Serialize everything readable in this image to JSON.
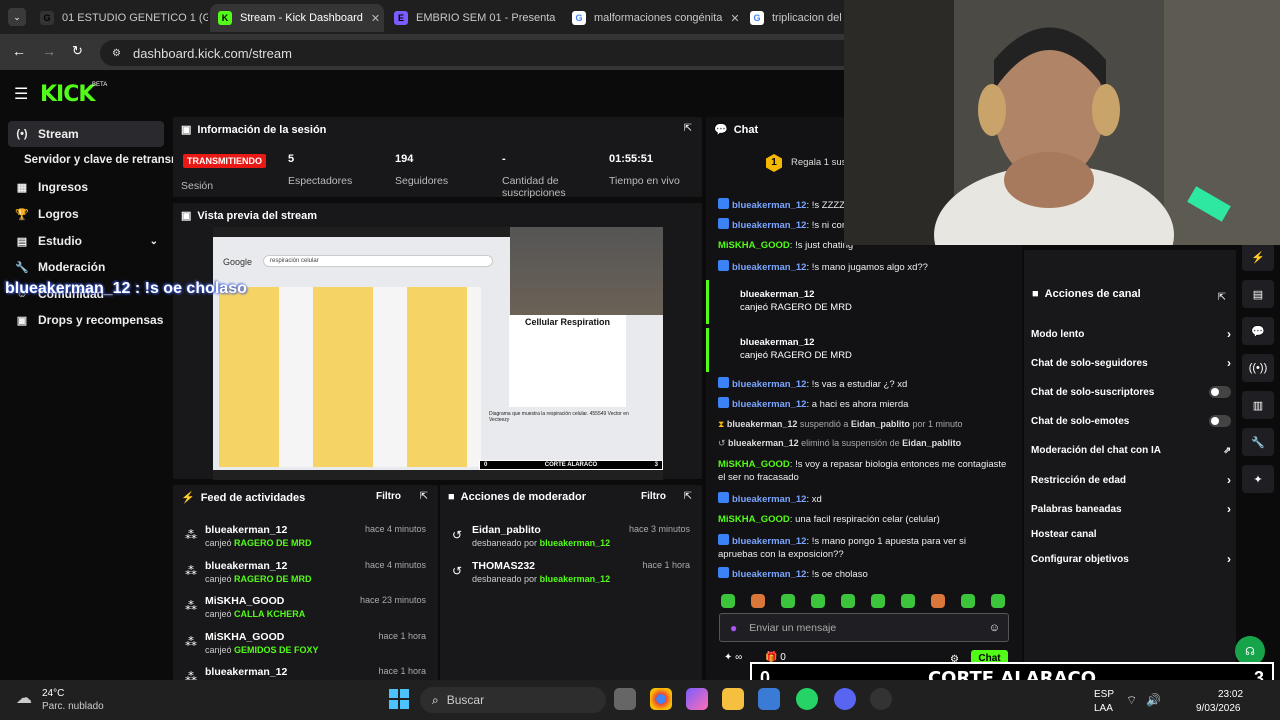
{
  "browser": {
    "tabs": [
      {
        "label": "01 ESTUDIO GENETICO 1 (G",
        "fav": "G",
        "color": "#333"
      },
      {
        "label": "Stream - Kick Dashboard",
        "fav": "K",
        "color": "#53fc18"
      },
      {
        "label": "EMBRIO SEM 01 - Presenta",
        "fav": "E",
        "color": "#7b5cff"
      },
      {
        "label": "malformaciones congénita",
        "fav": "G",
        "color": "#fff"
      },
      {
        "label": "triplicacion del cr",
        "fav": "G",
        "color": "#fff"
      }
    ],
    "url": "dashboard.kick.com/stream"
  },
  "kick": {
    "logo": "KICK",
    "beta": "BETA",
    "sidebar": [
      {
        "label": "Stream",
        "icon": "(•)"
      },
      {
        "label": "Servidor y clave de retransm",
        "icon": ""
      },
      {
        "label": "Ingresos",
        "icon": "▦"
      },
      {
        "label": "Logros",
        "icon": "🏆"
      },
      {
        "label": "Estudio",
        "icon": "▤"
      },
      {
        "label": "Moderación",
        "icon": "🔧"
      },
      {
        "label": "Comunidad",
        "icon": "☺"
      },
      {
        "label": "Drops y recompensas",
        "icon": "▣"
      }
    ],
    "overlay_chat": "blueakerman_12 : !s oe cholaso",
    "session": {
      "title": "Información de la sesión",
      "badge": "TRANSMITIENDO",
      "badge_label": "Sesión",
      "stats": [
        {
          "value": "5",
          "label": "Espectadores"
        },
        {
          "value": "194",
          "label": "Seguidores"
        },
        {
          "value": "-",
          "label": "Cantidad de suscripciones"
        },
        {
          "value": "01:55:51",
          "label": "Tiempo en vivo"
        }
      ]
    },
    "preview": {
      "title": "Vista previa del stream",
      "search_text": "respiración celular",
      "card_title": "Cellular Respiration",
      "card_caption": "Diagrama que muestra la respiración celular. 455549 Vector en Vecteezy",
      "bottom_text": "CORTE ALARACO",
      "score_left": "0",
      "score_right": "3"
    },
    "feed": {
      "title": "Feed de actividades",
      "filter": "Filtro",
      "rows": [
        {
          "user": "blueakerman_12",
          "action": "canjeó",
          "item": "RAGERO DE MRD",
          "time": "hace 4 minutos"
        },
        {
          "user": "blueakerman_12",
          "action": "canjeó",
          "item": "RAGERO DE MRD",
          "time": "hace 4 minutos"
        },
        {
          "user": "MiSKHA_GOOD",
          "action": "canjeó",
          "item": "CALLA KCHERA",
          "time": "hace 23 minutos"
        },
        {
          "user": "MiSKHA_GOOD",
          "action": "canjeó",
          "item": "GEMIDOS DE FOXY",
          "time": "hace 1 hora"
        },
        {
          "user": "blueakerman_12",
          "action": "",
          "item": "",
          "time": "hace 1 hora"
        }
      ]
    },
    "modactions": {
      "title": "Acciones de moderador",
      "filter": "Filtro",
      "rows": [
        {
          "user": "Eidan_pablito",
          "action": "desbaneado por",
          "by": "blueakerman_12",
          "time": "hace 3 minutos"
        },
        {
          "user": "THOMAS232",
          "action": "desbaneado por",
          "by": "blueakerman_12",
          "time": "hace 1 hora"
        }
      ]
    },
    "chat": {
      "title": "Chat",
      "gift_text": "Regala 1 susc",
      "gift_count": "1",
      "messages": [
        {
          "user": "blueakerman_12",
          "text": ": !s ZZZZZZ"
        },
        {
          "user": "blueakerman_12",
          "text": ": !s ni con el"
        },
        {
          "user": "MiSKHA_GOOD",
          "text": ": !s just chating"
        },
        {
          "user": "blueakerman_12",
          "text": ": !s mano jugamos algo xd??"
        }
      ],
      "redeems": [
        {
          "user": "blueakerman_12",
          "text": "canjeó RAGERO DE MRD"
        },
        {
          "user": "blueakerman_12",
          "text": "canjeó RAGERO DE MRD"
        }
      ],
      "messages2": [
        {
          "user": "blueakerman_12",
          "text": ": !s vas a estudiar ¿? xd"
        },
        {
          "user": "blueakerman_12",
          "text": ": a haci es ahora mierda"
        }
      ],
      "sys1": {
        "user": "blueakerman_12",
        "mid": " suspendió a ",
        "target": "Eidan_pablito",
        "end": " por 1 minuto"
      },
      "sys2": {
        "user": "blueakerman_12",
        "mid": " eliminó la suspensión de ",
        "target": "Eidan_pablito"
      },
      "messages3": [
        {
          "user": "MiSKHA_GOOD",
          "text": ": !s voy a repasar biologia entonces me contagiaste el ser no fracasado"
        },
        {
          "user": "blueakerman_12",
          "text": ": xd"
        },
        {
          "user": "MiSKHA_GOOD",
          "text": ": una facil respiración celar (celular)"
        },
        {
          "user": "blueakerman_12",
          "text": ": !s mano pongo 1 apuesta para ver si apruebas con la exposicion??"
        },
        {
          "user": "blueakerman_12",
          "text": ": !s oe cholaso"
        }
      ],
      "input_placeholder": "Enviar un mensaje",
      "points": "∞",
      "zero": "0",
      "send": "Chat"
    },
    "channel_actions": {
      "title": "Acciones de canal",
      "items": [
        {
          "label": "Modo lento",
          "ctl": "arrow"
        },
        {
          "label": "Chat de solo-seguidores",
          "ctl": "arrow"
        },
        {
          "label": "Chat de solo-suscriptores",
          "ctl": "toggle"
        },
        {
          "label": "Chat de solo-emotes",
          "ctl": "toggle"
        },
        {
          "label": "Moderación del chat con IA",
          "ctl": "ext"
        },
        {
          "label": "Restricción de edad",
          "ctl": "arrow"
        },
        {
          "label": "Palabras baneadas",
          "ctl": "arrow"
        },
        {
          "label": "Hostear canal",
          "ctl": "none"
        },
        {
          "label": "Configurar objetivos",
          "ctl": "arrow"
        }
      ]
    }
  },
  "overlay_score": {
    "left": "0",
    "title": "CORTE ALARACO",
    "right": "3"
  },
  "taskbar": {
    "temp": "24°C",
    "weather": "Parc. nublado",
    "search": "Buscar",
    "lang1": "ESP",
    "lang2": "LAA",
    "time": "23:02",
    "date": "9/03/2026"
  },
  "colors": {
    "accent": "#53fc18",
    "live": "#e91916",
    "username": "#7aa5ff"
  }
}
